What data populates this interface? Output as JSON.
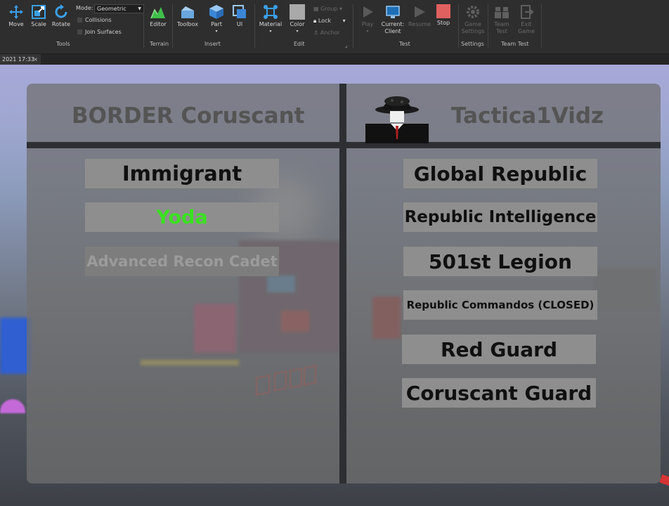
{
  "toolbar": {
    "tools_group": {
      "label": "Tools",
      "move": "Move",
      "scale": "Scale",
      "rotate": "Rotate",
      "mode_label": "Mode:",
      "mode_value": "Geometric",
      "collisions": "Collisions",
      "join_surfaces": "Join Surfaces"
    },
    "terrain_group": {
      "label": "Terrain",
      "editor": "Editor"
    },
    "insert_group": {
      "label": "Insert",
      "toolbox": "Toolbox",
      "part": "Part",
      "ui": "UI"
    },
    "edit_group": {
      "label": "Edit",
      "material": "Material",
      "color": "Color",
      "group": "Group",
      "lock": "Lock",
      "anchor": "Anchor"
    },
    "test_group": {
      "label": "Test",
      "play": "Play",
      "current_client_line1": "Current:",
      "current_client_line2": "Client",
      "resume": "Resume",
      "stop": "Stop"
    },
    "settings_group": {
      "label": "Settings",
      "game_settings_line1": "Game",
      "game_settings_line2": "Settings"
    },
    "team_test_group": {
      "label": "Team Test",
      "team_test_line1": "Team",
      "team_test_line2": "Test",
      "exit_game_line1": "Exit",
      "exit_game_line2": "Game"
    },
    "colors": {
      "accent": "#3aa0e8",
      "stop": "#e06060",
      "terrain": "#3fbf4a"
    }
  },
  "tabstrip": {
    "active_tab": "2021 17:33",
    "close": "×"
  },
  "border_gui": {
    "left_title": "BORDER Coruscant",
    "right_title": "Tactica1Vidz",
    "left_buttons": [
      {
        "label": "Immigrant",
        "style": "normal"
      },
      {
        "label": "Yoda",
        "style": "name"
      },
      {
        "label": "Advanced Recon Cadet",
        "style": "faded"
      }
    ],
    "right_buttons": [
      {
        "label": "Global Republic"
      },
      {
        "label": "Republic Intelligence"
      },
      {
        "label": "501st Legion"
      },
      {
        "label": "Republic Commandos (CLOSED)"
      },
      {
        "label": "Red Guard"
      },
      {
        "label": "Coruscant Guard"
      }
    ],
    "colors": {
      "name_text": "#39e21f",
      "button_bg": "#8e8e8e",
      "title_text": "#545454"
    }
  }
}
